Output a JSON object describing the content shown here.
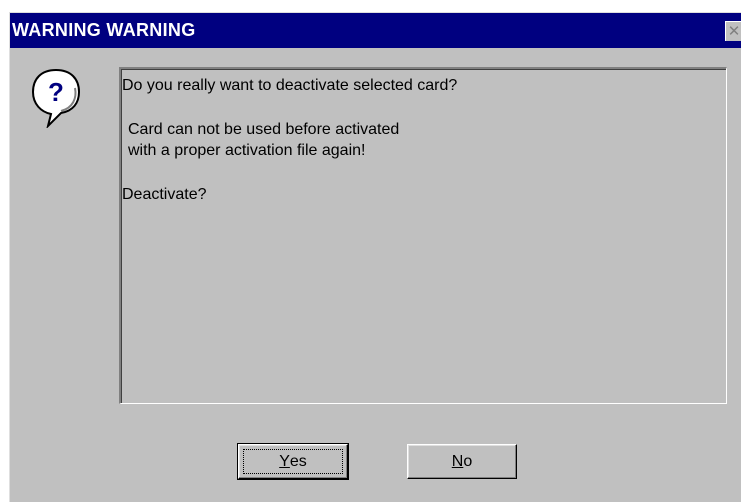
{
  "window": {
    "title": "WARNING WARNING",
    "close_glyph": "✕"
  },
  "icon": {
    "name": "question-icon",
    "glyph": "?"
  },
  "message": {
    "line1": "Do you really want to deactivate selected card?",
    "line2": "Card can not be used before activated",
    "line3": "with a proper activation file again!",
    "line4": "Deactivate?"
  },
  "buttons": {
    "yes": {
      "access_key": "Y",
      "rest": "es"
    },
    "no": {
      "access_key": "N",
      "rest": "o"
    }
  },
  "colors": {
    "titlebar": "#000080",
    "face": "#c0c0c0",
    "icon_glyph": "#000080"
  }
}
